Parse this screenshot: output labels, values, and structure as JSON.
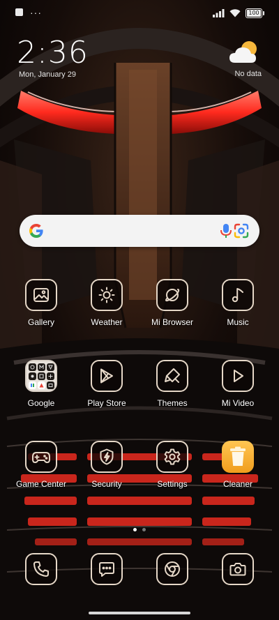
{
  "status_bar": {
    "battery_level": "100",
    "more_indicator": "···"
  },
  "clock": {
    "time": "2:36",
    "date": "Mon, January 29"
  },
  "weather_widget": {
    "status": "No data",
    "icon": "partly-cloudy-icon"
  },
  "search_bar": {
    "icons": [
      "google-g-icon",
      "voice-search-icon",
      "lens-icon"
    ]
  },
  "apps": [
    {
      "label": "Gallery",
      "icon": "gallery-icon"
    },
    {
      "label": "Weather",
      "icon": "sun-icon"
    },
    {
      "label": "Mi Browser",
      "icon": "planet-icon"
    },
    {
      "label": "Music",
      "icon": "music-note-icon"
    },
    {
      "label": "Google",
      "icon": "folder-icon"
    },
    {
      "label": "Play Store",
      "icon": "play-store-icon"
    },
    {
      "label": "Themes",
      "icon": "brush-icon"
    },
    {
      "label": "Mi Video",
      "icon": "play-icon"
    },
    {
      "label": "Game Center",
      "icon": "gamepad-icon"
    },
    {
      "label": "Security",
      "icon": "shield-bolt-icon"
    },
    {
      "label": "Settings",
      "icon": "gear-icon"
    },
    {
      "label": "Cleaner",
      "icon": "trash-icon"
    }
  ],
  "page_indicator": {
    "pages": 2,
    "current": 1
  },
  "dock": [
    "phone-icon",
    "messages-icon",
    "chrome-icon",
    "camera-icon"
  ],
  "colors": {
    "icon_stroke": "#e6d8c8",
    "visor_red": "#ff2a1e",
    "search_bg": "#f3f3f3",
    "cleaner_orange": "#f5a623"
  }
}
